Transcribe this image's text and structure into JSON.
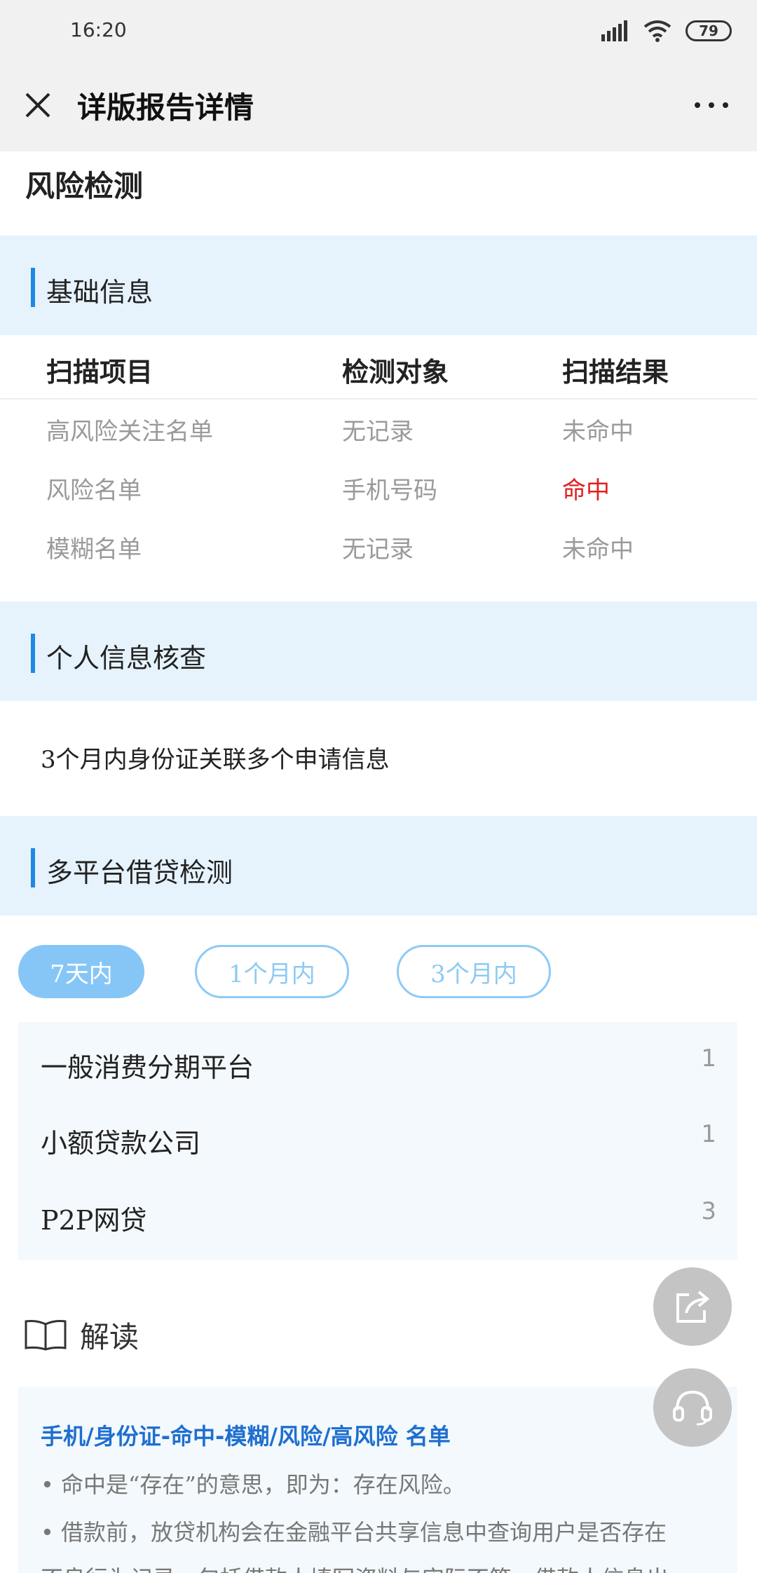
{
  "status": {
    "time": "16:20",
    "battery": "79"
  },
  "app_bar": {
    "title": "详版报告详情"
  },
  "page": {
    "title": "风险检测"
  },
  "sections": {
    "basic": "基础信息",
    "personal": "个人信息核查",
    "multi": "多平台借贷检测"
  },
  "table": {
    "headers": [
      "扫描项目",
      "检测对象",
      "扫描结果"
    ],
    "rows": [
      [
        "高风险关注名单",
        "无记录",
        "未命中"
      ],
      [
        "风险名单",
        "手机号码",
        "命中"
      ],
      [
        "模糊名单",
        "无记录",
        "未命中"
      ]
    ]
  },
  "personal_text": "3个月内身份证关联多个申请信息",
  "tabs": [
    "7天内",
    "1个月内",
    "3个月内"
  ],
  "platforms": [
    {
      "name": "一般消费分期平台",
      "count": "1"
    },
    {
      "name": "小额贷款公司",
      "count": "1"
    },
    {
      "name": "P2P网贷",
      "count": "3"
    }
  ],
  "interpretation": {
    "label": "解读",
    "title": "手机/身份证-命中-模糊/风险/高风险 名单",
    "bullets": [
      "• 命中是“存在”的意思，即为：存在风险。",
      "• 借款前，放贷机构会在金融平台共享信息中查询用户是否存在",
      "不良行为记录，包括借款人填写资料与实际不符、借款人信息出"
    ]
  },
  "colors": {
    "accent": "#1e88e5",
    "band": "#e6f3fd",
    "hit": "#e02020",
    "pill": "#86c6f7"
  }
}
